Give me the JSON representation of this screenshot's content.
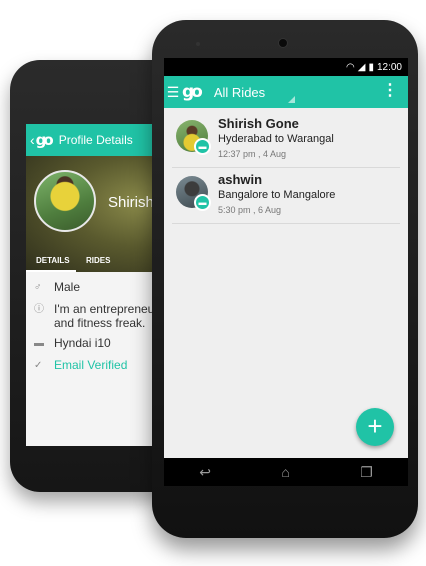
{
  "back_phone": {
    "header_title": "Profile Details",
    "profile_name": "Shirish",
    "tabs": [
      "DETAILS",
      "RIDES"
    ],
    "details": [
      {
        "icon": "gender-icon",
        "text": "Male"
      },
      {
        "icon": "info-icon",
        "text": "I'm an entrepreneur.. and fitness freak."
      },
      {
        "icon": "car-icon",
        "text": "Hyndai i10"
      },
      {
        "icon": "check-icon",
        "text": "Email Verified"
      }
    ]
  },
  "status_bar": {
    "time": "12:00"
  },
  "app_bar": {
    "title": "All Rides"
  },
  "rides": [
    {
      "name": "Shirish Gone",
      "route": "Hyderabad to Warangal",
      "time": "12:37 pm , 4 Aug"
    },
    {
      "name": "ashwin",
      "route": "Bangalore to Mangalore",
      "time": "5:30 pm , 6 Aug"
    }
  ],
  "fab": {
    "label": "+"
  },
  "colors": {
    "accent": "#20c3a6",
    "verified": "#20c3a6"
  }
}
